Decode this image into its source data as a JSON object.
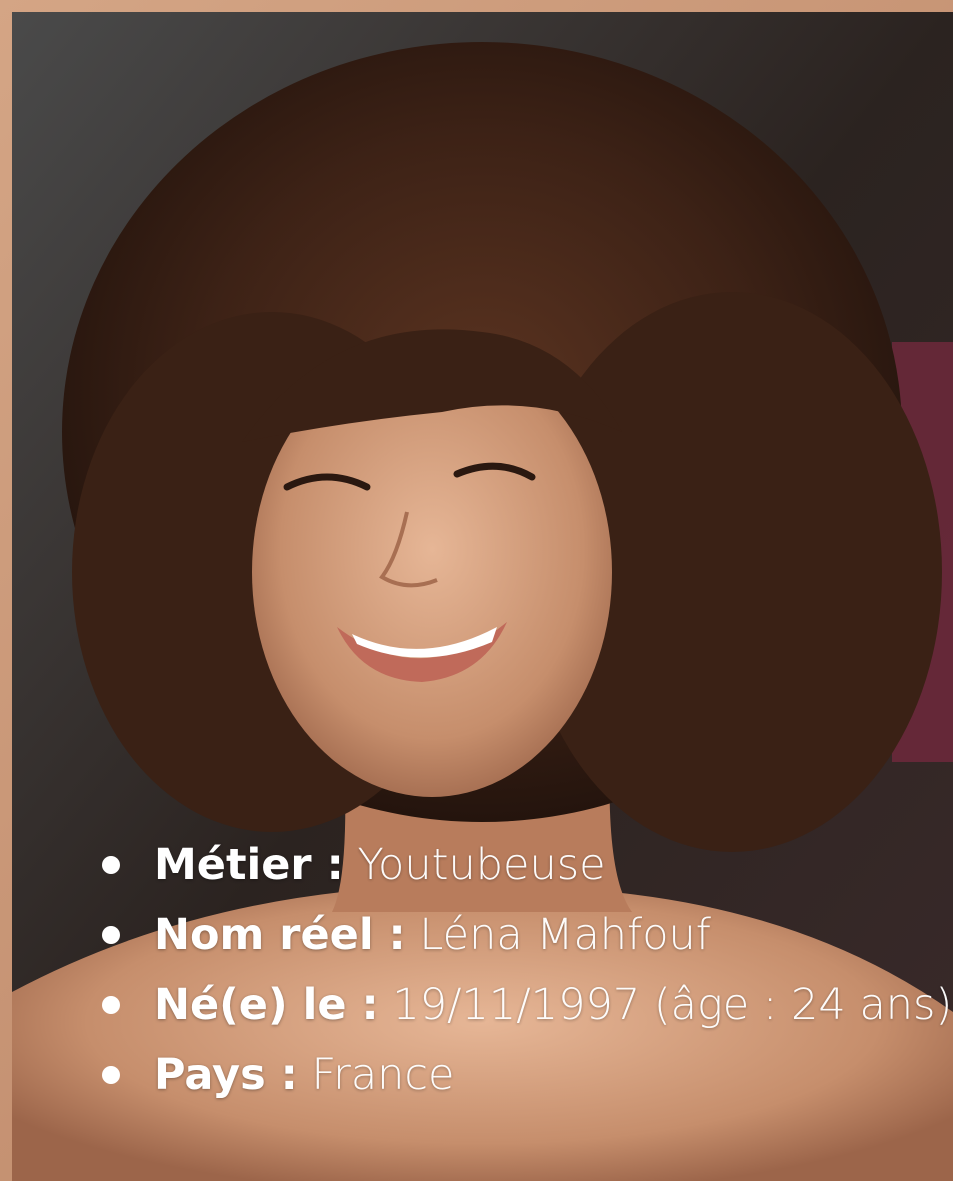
{
  "profile": {
    "items": [
      {
        "label": "Métier :",
        "value": "Youtubeuse"
      },
      {
        "label": "Nom réel :",
        "value": "Léna Mahfouf"
      },
      {
        "label": "Né(e) le :",
        "value": "19/11/1997 (âge : 24 ans)"
      },
      {
        "label": "Pays :",
        "value": "France"
      }
    ]
  },
  "colors": {
    "border": "#c89a7c",
    "text": "#ffffff",
    "hair": "#3b2115",
    "skin": "#d9a98a"
  }
}
